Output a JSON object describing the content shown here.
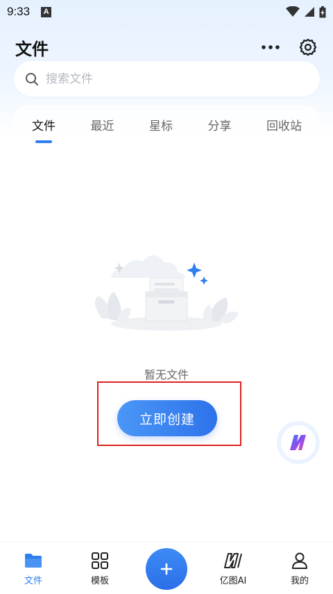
{
  "status_bar": {
    "time": "9:33",
    "notification_letter": "A"
  },
  "header": {
    "title": "文件"
  },
  "search": {
    "placeholder": "搜索文件"
  },
  "tabs": [
    {
      "label": "文件",
      "active": true
    },
    {
      "label": "最近",
      "active": false
    },
    {
      "label": "星标",
      "active": false
    },
    {
      "label": "分享",
      "active": false
    },
    {
      "label": "回收站",
      "active": false
    }
  ],
  "empty_state": {
    "message": "暂无文件",
    "button_label": "立即创建"
  },
  "bottom_nav": {
    "items": [
      {
        "label": "文件",
        "icon": "folder-icon",
        "active": true
      },
      {
        "label": "模板",
        "icon": "grid-icon",
        "active": false
      },
      {
        "label": "亿图AI",
        "icon": "edraw-ai-icon",
        "active": false
      },
      {
        "label": "我的",
        "icon": "user-icon",
        "active": false
      }
    ],
    "center_icon": "plus-icon"
  },
  "colors": {
    "accent": "#2f7ef0",
    "highlight_border": "#e02020",
    "background_top": "#e6f1ff"
  }
}
